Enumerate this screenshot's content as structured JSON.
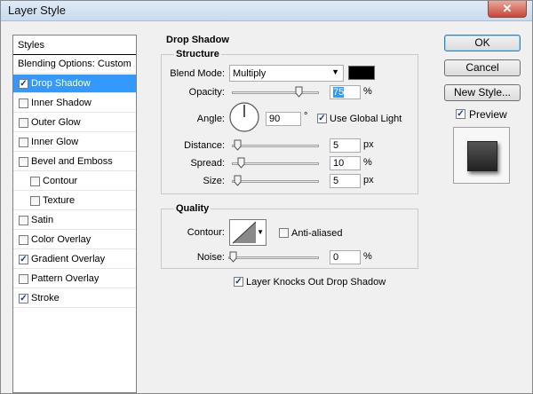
{
  "window": {
    "title": "Layer Style",
    "close_glyph": "✕"
  },
  "styles": {
    "header": "Styles",
    "items": [
      {
        "label": "Blending Options: Custom",
        "checkbox": false,
        "checked": false,
        "indent": false,
        "selected": false
      },
      {
        "label": "Drop Shadow",
        "checkbox": true,
        "checked": true,
        "indent": false,
        "selected": true
      },
      {
        "label": "Inner Shadow",
        "checkbox": true,
        "checked": false,
        "indent": false,
        "selected": false
      },
      {
        "label": "Outer Glow",
        "checkbox": true,
        "checked": false,
        "indent": false,
        "selected": false
      },
      {
        "label": "Inner Glow",
        "checkbox": true,
        "checked": false,
        "indent": false,
        "selected": false
      },
      {
        "label": "Bevel and Emboss",
        "checkbox": true,
        "checked": false,
        "indent": false,
        "selected": false
      },
      {
        "label": "Contour",
        "checkbox": true,
        "checked": false,
        "indent": true,
        "selected": false
      },
      {
        "label": "Texture",
        "checkbox": true,
        "checked": false,
        "indent": true,
        "selected": false
      },
      {
        "label": "Satin",
        "checkbox": true,
        "checked": false,
        "indent": false,
        "selected": false
      },
      {
        "label": "Color Overlay",
        "checkbox": true,
        "checked": false,
        "indent": false,
        "selected": false
      },
      {
        "label": "Gradient Overlay",
        "checkbox": true,
        "checked": true,
        "indent": false,
        "selected": false
      },
      {
        "label": "Pattern Overlay",
        "checkbox": true,
        "checked": false,
        "indent": false,
        "selected": false
      },
      {
        "label": "Stroke",
        "checkbox": true,
        "checked": true,
        "indent": false,
        "selected": false
      }
    ]
  },
  "drop_shadow": {
    "section_title": "Drop Shadow",
    "structure": {
      "title": "Structure",
      "blend_mode_label": "Blend Mode:",
      "blend_mode_value": "Multiply",
      "shadow_color": "#000000",
      "opacity_label": "Opacity:",
      "opacity_value": "75",
      "opacity_unit": "%",
      "angle_label": "Angle:",
      "angle_value": "90",
      "angle_unit": "°",
      "use_global_light_label": "Use Global Light",
      "use_global_light_checked": true,
      "distance_label": "Distance:",
      "distance_value": "5",
      "distance_unit": "px",
      "spread_label": "Spread:",
      "spread_value": "10",
      "spread_unit": "%",
      "size_label": "Size:",
      "size_value": "5",
      "size_unit": "px"
    },
    "quality": {
      "title": "Quality",
      "contour_label": "Contour:",
      "anti_aliased_label": "Anti-aliased",
      "anti_aliased_checked": false,
      "noise_label": "Noise:",
      "noise_value": "0",
      "noise_unit": "%"
    },
    "knockout_label": "Layer Knocks Out Drop Shadow",
    "knockout_checked": true
  },
  "buttons": {
    "ok": "OK",
    "cancel": "Cancel",
    "new_style": "New Style..."
  },
  "preview": {
    "label": "Preview",
    "checked": true
  },
  "colors": {
    "selection": "#3399ff",
    "title_bar": "#c9dbee",
    "close": "#c7473a"
  }
}
